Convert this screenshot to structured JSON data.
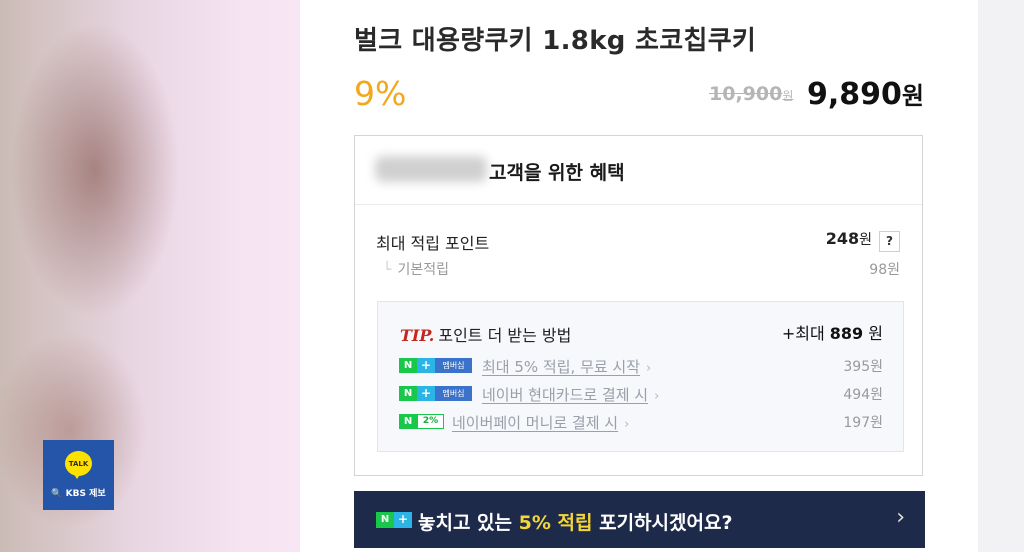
{
  "product": {
    "title": "벌크 대용량쿠키 1.8kg 초코칩쿠키",
    "discount": "9%",
    "original_price": "10,900",
    "original_unit": "원",
    "sale_price": "9,890",
    "sale_unit": "원"
  },
  "benefits": {
    "title": "고객을 위한 혜택",
    "max_points_label": "최대 적립 포인트",
    "max_points_value": "248",
    "max_points_unit": "원",
    "help_label": "?",
    "basic_label": "기본적립",
    "basic_value": "98원",
    "tip": {
      "mark": "TIP.",
      "title": "포인트 더 받는 방법",
      "total_prefix": "+최대",
      "total_value": "889",
      "total_unit": "원",
      "rows": [
        {
          "badge_n": "N",
          "badge_plus": "+",
          "badge_member": "멤버십",
          "label": "최대 5% 적립, 무료 시작",
          "value": "395원"
        },
        {
          "badge_n": "N",
          "badge_plus": "+",
          "badge_member": "멤버십",
          "label": "네이버 현대카드로 결제 시",
          "value": "494원"
        },
        {
          "badge_n": "N",
          "badge_pct": "2%",
          "label": "네이버페이 머니로 결제 시",
          "value": "197원"
        }
      ],
      "arrow": "›"
    }
  },
  "promo": {
    "badge_n": "N",
    "badge_plus": "+",
    "text_before": "놓치고 있는 ",
    "highlight": "5% 적립",
    "text_after": " 포기하시겠어요?",
    "arrow": "›"
  },
  "overlay": {
    "talk_label": "TALK",
    "kbs_label": "🔍 KBS 제보"
  },
  "colors": {
    "discount": "#f0a81e",
    "naver_green": "#19c84a",
    "plus_blue": "#2bb4e6",
    "banner_navy": "#1e2a4a",
    "banner_highlight": "#f5d63a",
    "tip_red": "#c4261d",
    "kbs_blue": "#2455a8"
  }
}
